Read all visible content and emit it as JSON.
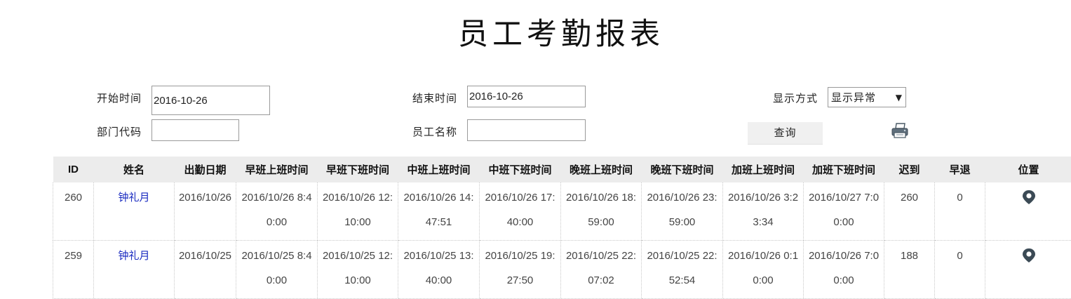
{
  "page": {
    "title": "员工考勤报表"
  },
  "filters": {
    "start_label": "开始时间",
    "start_value": "2016-10-26",
    "end_label": "结束时间",
    "end_value": "2016-10-26",
    "display_label": "显示方式",
    "display_value": "显示异常",
    "dept_label": "部门代码",
    "dept_value": "",
    "name_label": "员工名称",
    "name_value": "",
    "query_label": "查询"
  },
  "table": {
    "headers": [
      "ID",
      "姓名",
      "出勤日期",
      "早班上班时间",
      "早班下班时间",
      "中班上班时间",
      "中班下班时间",
      "晚班上班时间",
      "晚班下班时间",
      "加班上班时间",
      "加班下班时间",
      "迟到",
      "早退",
      "位置"
    ],
    "rows": [
      {
        "id": "260",
        "name": "钟礼月",
        "date": "2016/10/26",
        "morning_in": "2016/10/26 8:40:00",
        "morning_out": "2016/10/26 12:10:00",
        "noon_in": "2016/10/26 14:47:51",
        "noon_out": "2016/10/26 17:40:00",
        "night_in": "2016/10/26 18:59:00",
        "night_out": "2016/10/26 23:59:00",
        "ot_in": "2016/10/26 3:23:34",
        "ot_out": "2016/10/27 7:00:00",
        "late": "260",
        "early": "0",
        "location_icon": "location-pin-icon"
      },
      {
        "id": "259",
        "name": "钟礼月",
        "date": "2016/10/25",
        "morning_in": "2016/10/25 8:40:00",
        "morning_out": "2016/10/25 12:10:00",
        "noon_in": "2016/10/25 13:40:00",
        "noon_out": "2016/10/25 19:27:50",
        "night_in": "2016/10/25 22:07:02",
        "night_out": "2016/10/25 22:52:54",
        "ot_in": "2016/10/26 0:10:00",
        "ot_out": "2016/10/26 7:00:00",
        "late": "188",
        "early": "0",
        "location_icon": "location-pin-icon"
      }
    ]
  },
  "colors": {
    "header_bg": "#ececec",
    "name_link": "#1a2bc0",
    "pin": "#3b4a55"
  }
}
